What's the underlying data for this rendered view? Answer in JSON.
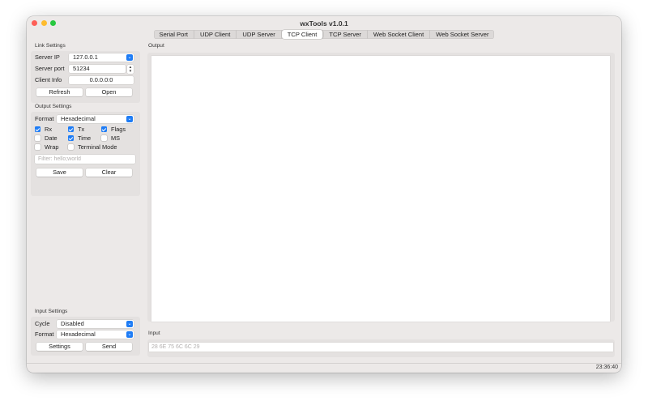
{
  "window": {
    "title": "wxTools v1.0.1"
  },
  "tabs": [
    "Serial Port",
    "UDP Client",
    "UDP Server",
    "TCP Client",
    "TCP Server",
    "Web Socket Client",
    "Web Socket Server"
  ],
  "active_tab": "TCP Client",
  "link_settings": {
    "title": "Link Settings",
    "server_ip_label": "Server IP",
    "server_ip_value": "127.0.0.1",
    "server_port_label": "Server port",
    "server_port_value": "51234",
    "client_info_label": "Client Info",
    "client_info_value": "0.0.0.0:0",
    "refresh_label": "Refresh",
    "open_label": "Open"
  },
  "output_settings": {
    "title": "Output Settings",
    "format_label": "Format",
    "format_value": "Hexadecimal",
    "checks": {
      "rx": {
        "label": "Rx",
        "checked": true
      },
      "tx": {
        "label": "Tx",
        "checked": true
      },
      "flags": {
        "label": "Flags",
        "checked": true
      },
      "date": {
        "label": "Date",
        "checked": false
      },
      "time": {
        "label": "Time",
        "checked": true
      },
      "ms": {
        "label": "MS",
        "checked": false
      },
      "wrap": {
        "label": "Wrap",
        "checked": false
      },
      "terminal": {
        "label": "Terminal Mode",
        "checked": false
      }
    },
    "filter_placeholder": "Filter: hello;world",
    "save_label": "Save",
    "clear_label": "Clear"
  },
  "input_settings": {
    "title": "Input Settings",
    "cycle_label": "Cycle",
    "cycle_value": "Disabled",
    "format_label": "Format",
    "format_value": "Hexadecimal",
    "settings_label": "Settings",
    "send_label": "Send"
  },
  "output": {
    "title": "Output"
  },
  "input": {
    "title": "Input",
    "placeholder": "28 6E 75 6C 6C 29"
  },
  "status": {
    "time": "23:36:40"
  },
  "colors": {
    "accent": "#1e7cf5",
    "window_bg": "#ece9e8",
    "group_bg": "#e4e1e0"
  }
}
